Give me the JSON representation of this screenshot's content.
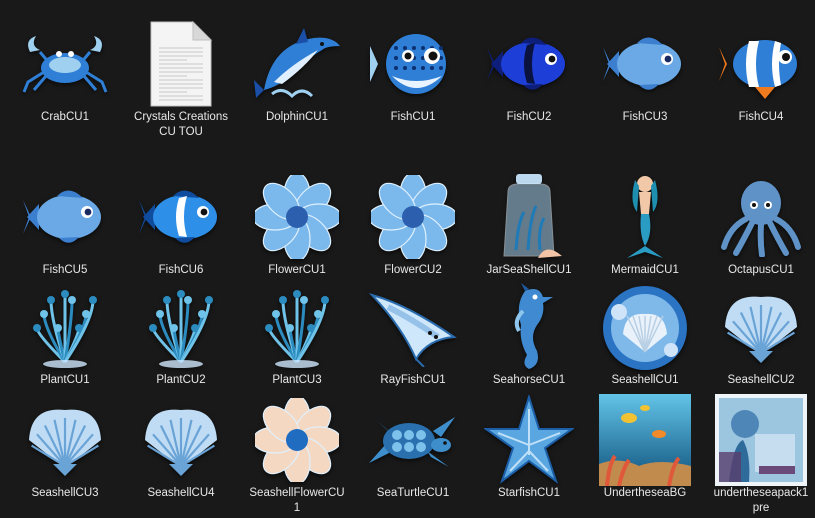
{
  "window": {
    "view": "Large icons"
  },
  "files": [
    {
      "name": "CrabCU1",
      "icon": "crab-icon",
      "type": "image"
    },
    {
      "name": "Crystals Creations CU TOU",
      "icon": "text-document-icon",
      "type": "document"
    },
    {
      "name": "DolphinCU1",
      "icon": "dolphin-icon",
      "type": "image"
    },
    {
      "name": "FishCU1",
      "icon": "pufferfish-icon",
      "type": "image"
    },
    {
      "name": "FishCU2",
      "icon": "blue-tang-fish-icon",
      "type": "image"
    },
    {
      "name": "FishCU3",
      "icon": "fish-icon",
      "type": "image"
    },
    {
      "name": "FishCU4",
      "icon": "clownfish-icon",
      "type": "image"
    },
    {
      "name": "FishCU5",
      "icon": "fish-icon",
      "type": "image"
    },
    {
      "name": "FishCU6",
      "icon": "tropical-fish-icon",
      "type": "image"
    },
    {
      "name": "FlowerCU1",
      "icon": "flower-icon",
      "type": "image"
    },
    {
      "name": "FlowerCU2",
      "icon": "flower-icon",
      "type": "image"
    },
    {
      "name": "JarSeaShellCU1",
      "icon": "jar-icon",
      "type": "image"
    },
    {
      "name": "MermaidCU1",
      "icon": "mermaid-icon",
      "type": "image"
    },
    {
      "name": "OctapusCU1",
      "icon": "octopus-icon",
      "type": "image"
    },
    {
      "name": "PlantCU1",
      "icon": "plant-icon",
      "type": "image"
    },
    {
      "name": "PlantCU2",
      "icon": "plant-icon",
      "type": "image"
    },
    {
      "name": "PlantCU3",
      "icon": "plant-icon",
      "type": "image"
    },
    {
      "name": "RayFishCU1",
      "icon": "manta-ray-icon",
      "type": "image"
    },
    {
      "name": "SeahorseCU1",
      "icon": "seahorse-icon",
      "type": "image"
    },
    {
      "name": "SeashellCU1",
      "icon": "shell-cluster-icon",
      "type": "image"
    },
    {
      "name": "SeashellCU2",
      "icon": "scallop-shell-icon",
      "type": "image"
    },
    {
      "name": "SeashellCU3",
      "icon": "scallop-shell-icon",
      "type": "image"
    },
    {
      "name": "SeashellCU4",
      "icon": "scallop-shell-icon",
      "type": "image"
    },
    {
      "name": "SeashellFlowerCU1",
      "icon": "shell-flower-icon",
      "type": "image"
    },
    {
      "name": "SeaTurtleCU1",
      "icon": "sea-turtle-icon",
      "type": "image"
    },
    {
      "name": "StarfishCU1",
      "icon": "starfish-icon",
      "type": "image"
    },
    {
      "name": "UndertheseaBG",
      "icon": "underwater-scene-icon",
      "type": "image"
    },
    {
      "name": "undertheseapack1pre",
      "icon": "preview-collage-icon",
      "type": "image"
    }
  ],
  "colors": {
    "background": "#191919",
    "label": "#e8e8e8",
    "accent_blue": "#2f7fd6",
    "light_blue": "#9fd0f0",
    "deep_blue": "#1a4fa8",
    "orange": "#f07a1e"
  }
}
